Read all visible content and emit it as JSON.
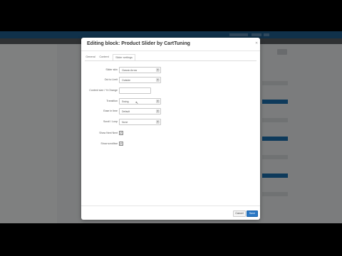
{
  "modal": {
    "title": "Editing block: Product Slider by CartTuning",
    "close_icon": "close-icon",
    "tabs": [
      {
        "label": "General",
        "active": false
      },
      {
        "label": "Content",
        "active": false
      },
      {
        "label": "Slider settings",
        "active": true
      }
    ],
    "fields": [
      {
        "label": "Slider skin",
        "type": "select",
        "value": "Classic Arrow"
      },
      {
        "label": "Out to Limit",
        "type": "select",
        "value": "Outside"
      },
      {
        "label": "Content size / % Change",
        "type": "input",
        "value": ""
      },
      {
        "label": "Transition",
        "type": "select",
        "value": "Swing"
      },
      {
        "label": "Ease in time",
        "type": "select",
        "value": "Default"
      },
      {
        "label": "Scroll / Loop",
        "type": "select",
        "value": "None"
      },
      {
        "label": "Show Next Next",
        "type": "checkbox",
        "checked": true
      },
      {
        "label": "Show scrollbar",
        "type": "checkbox",
        "checked": true
      }
    ],
    "footer": {
      "cancel_label": "Cancel",
      "save_label": "Save"
    }
  },
  "background": {
    "colors": {
      "topbar": "#1f5f8f",
      "accent": "#1b6fae",
      "overlay": "#000000"
    }
  }
}
